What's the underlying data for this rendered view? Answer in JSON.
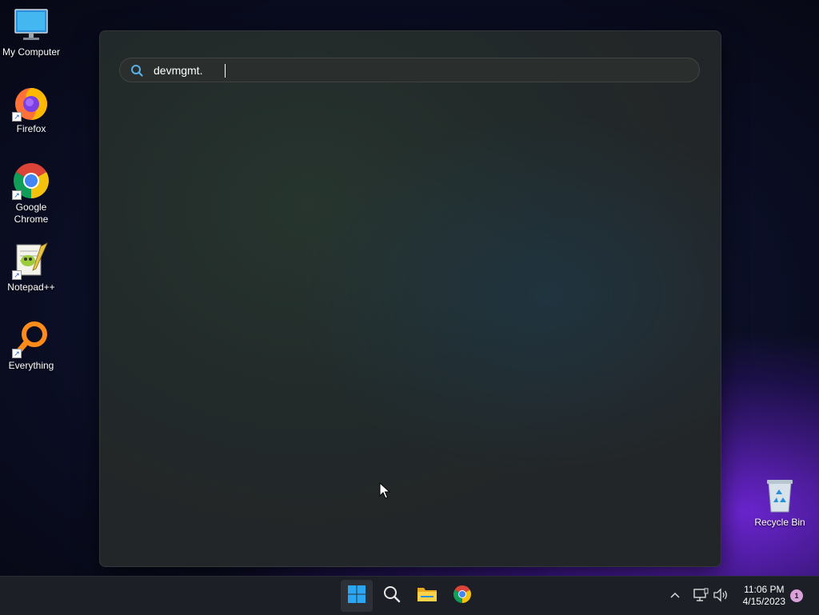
{
  "desktop": {
    "icons": [
      {
        "label": "My Computer",
        "icon": "monitor-icon"
      },
      {
        "label": "Firefox",
        "icon": "firefox-icon"
      },
      {
        "label": "Google Chrome",
        "icon": "chrome-icon"
      },
      {
        "label": "Notepad++",
        "icon": "notepadpp-icon"
      },
      {
        "label": "Everything",
        "icon": "everything-icon"
      },
      {
        "label": "Recycle Bin",
        "icon": "recycle-bin-icon"
      }
    ]
  },
  "search_panel": {
    "query": "devmgmt.",
    "icon": "search-icon"
  },
  "taskbar": {
    "buttons": [
      {
        "name": "start",
        "icon": "windows-logo-icon",
        "active": true
      },
      {
        "name": "search",
        "icon": "search-icon"
      },
      {
        "name": "file-explorer",
        "icon": "folder-icon"
      },
      {
        "name": "chrome",
        "icon": "chrome-icon"
      }
    ],
    "tray": {
      "time": "11:06 PM",
      "date": "4/15/2023",
      "notification_count": "1"
    }
  },
  "colors": {
    "accent": "#1a8cff",
    "taskbar_bg": "#1c1f26",
    "panel_bg": "#25302c"
  }
}
